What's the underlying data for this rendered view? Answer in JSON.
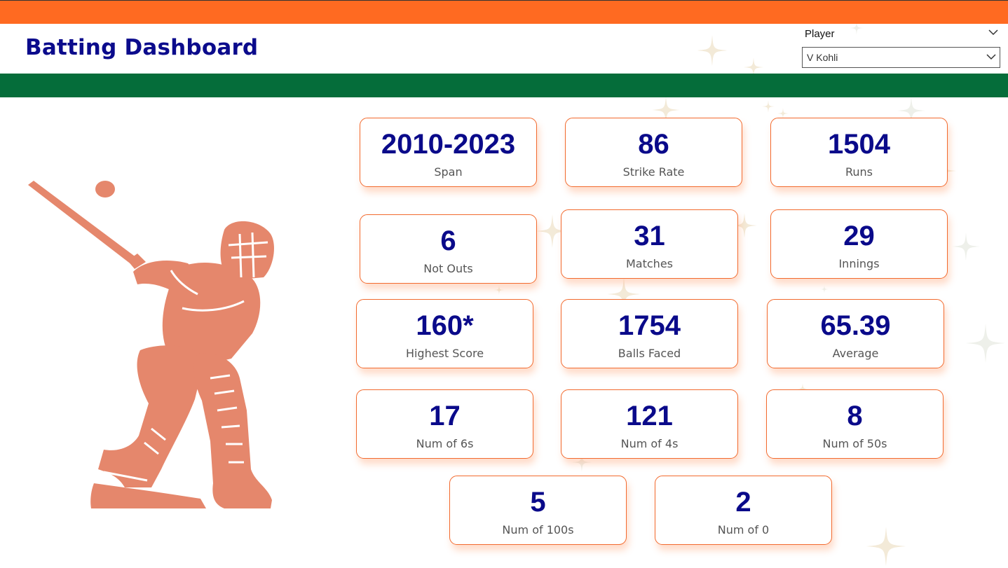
{
  "header": {
    "title": "Batting Dashboard",
    "colors": {
      "top_bar": "#ff6a21",
      "green_bar": "#056d3a",
      "title_text": "#0b0b8c"
    }
  },
  "slicer": {
    "label": "Player",
    "selected_value": "V Kohli",
    "chevron_icon": "chevron-down-icon"
  },
  "illustration": {
    "icon": "cricket-batsman-icon",
    "color": "#e5876c"
  },
  "cards": [
    {
      "value": "2010-2023",
      "label": "Span"
    },
    {
      "value": "86",
      "label": "Strike Rate"
    },
    {
      "value": "1504",
      "label": "Runs"
    },
    {
      "value": "6",
      "label": "Not Outs"
    },
    {
      "value": "31",
      "label": "Matches"
    },
    {
      "value": "29",
      "label": "Innings"
    },
    {
      "value": "160*",
      "label": "Highest Score"
    },
    {
      "value": "1754",
      "label": "Balls Faced"
    },
    {
      "value": "65.39",
      "label": "Average"
    },
    {
      "value": "17",
      "label": "Num of 6s"
    },
    {
      "value": "121",
      "label": "Num of 4s"
    },
    {
      "value": "8",
      "label": "Num of 50s"
    },
    {
      "value": "5",
      "label": "Num of 100s"
    },
    {
      "value": "2",
      "label": "Num of 0"
    }
  ],
  "card_style": {
    "border_color": "#f26a2e",
    "value_color": "#0a0a8a",
    "label_color": "#555555"
  }
}
